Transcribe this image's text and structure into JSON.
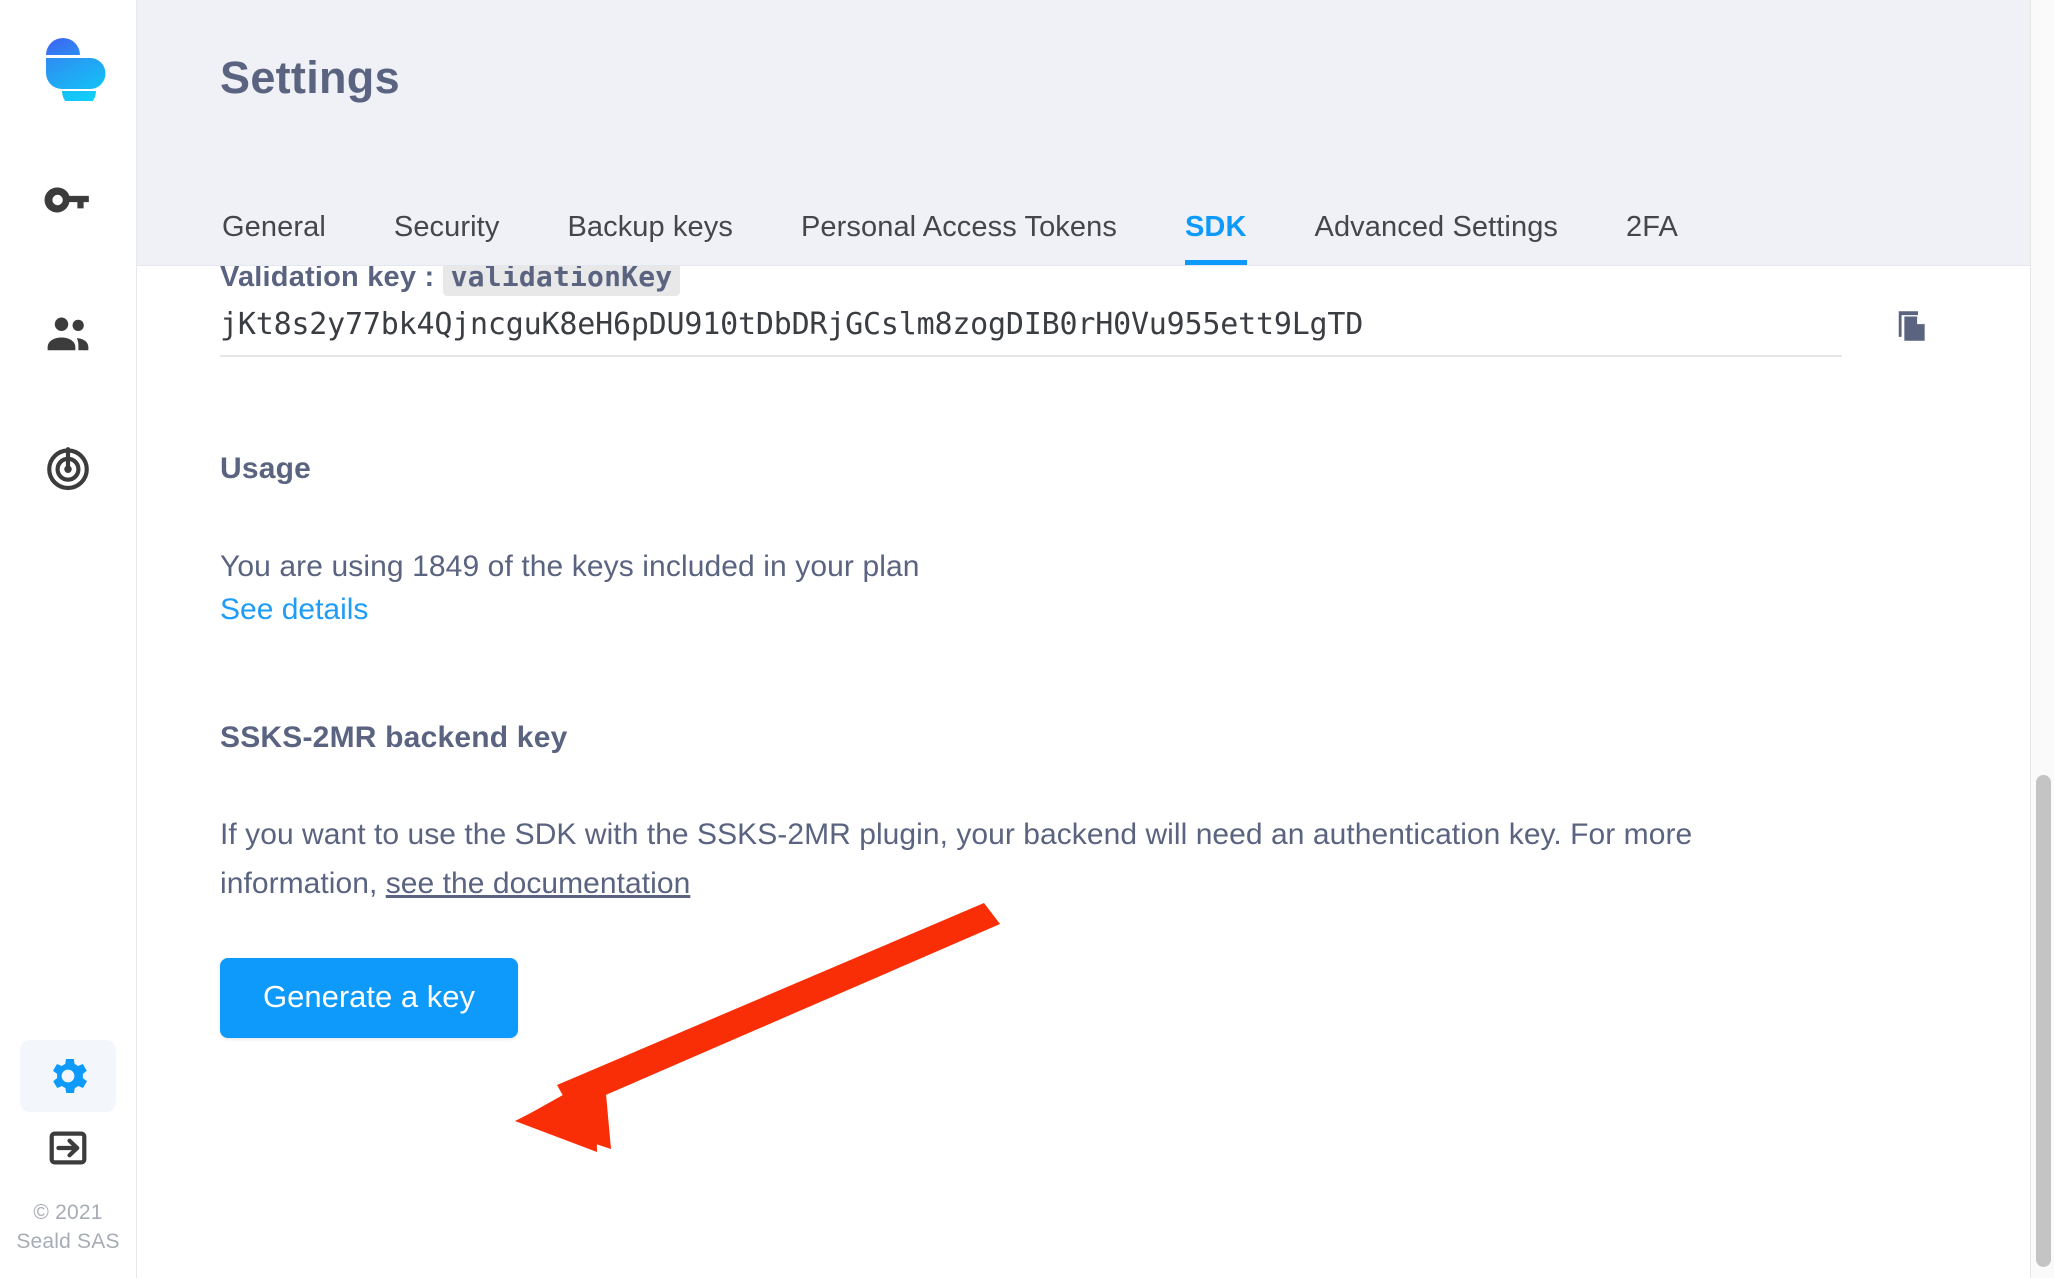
{
  "app": {
    "logo_icon": "seald-logo-icon",
    "copyright_line1": "© 2021",
    "copyright_line2": "Seald SAS"
  },
  "sidebar": {
    "items": [
      {
        "name": "keys",
        "icon": "key-icon",
        "active": false
      },
      {
        "name": "users",
        "icon": "people-icon",
        "active": false
      },
      {
        "name": "activity",
        "icon": "radar-icon",
        "active": false
      }
    ],
    "bottom_items": [
      {
        "name": "settings",
        "icon": "gear-icon",
        "active": true
      },
      {
        "name": "logout",
        "icon": "logout-icon",
        "active": false
      }
    ]
  },
  "header": {
    "title": "Settings"
  },
  "tabs": [
    {
      "label": "General",
      "active": false
    },
    {
      "label": "Security",
      "active": false
    },
    {
      "label": "Backup keys",
      "active": false
    },
    {
      "label": "Personal Access Tokens",
      "active": false
    },
    {
      "label": "SDK",
      "active": true
    },
    {
      "label": "Advanced Settings",
      "active": false
    },
    {
      "label": "2FA",
      "active": false
    }
  ],
  "sdk_panel": {
    "validation_key": {
      "label": "Validation key : ",
      "code_token": "validationKey",
      "value": "jKt8s2y77bk4QjncguK8eH6pDU910tDbDRjGCslm8zogDIB0rH0Vu955ett9LgTD",
      "copy_icon": "copy-icon"
    },
    "usage": {
      "heading": "Usage",
      "text": "You are using 1849 of the keys included in your plan",
      "link": "See details",
      "keys_used": 1849
    },
    "ssks": {
      "heading": "SSKS-2MR backend key",
      "paragraph_before": "If you want to use the SDK with the SSKS-2MR plugin, your backend will need an authentication key. For more information, ",
      "link": "see the documentation",
      "generate_button": "Generate a key"
    }
  },
  "colors": {
    "accent": "#0d9afb",
    "text_slate": "#5a6480",
    "page_bg": "#eff1f6",
    "annotation_red": "#f92e06"
  },
  "scrollbar": {
    "name": "vertical-scrollbar"
  }
}
